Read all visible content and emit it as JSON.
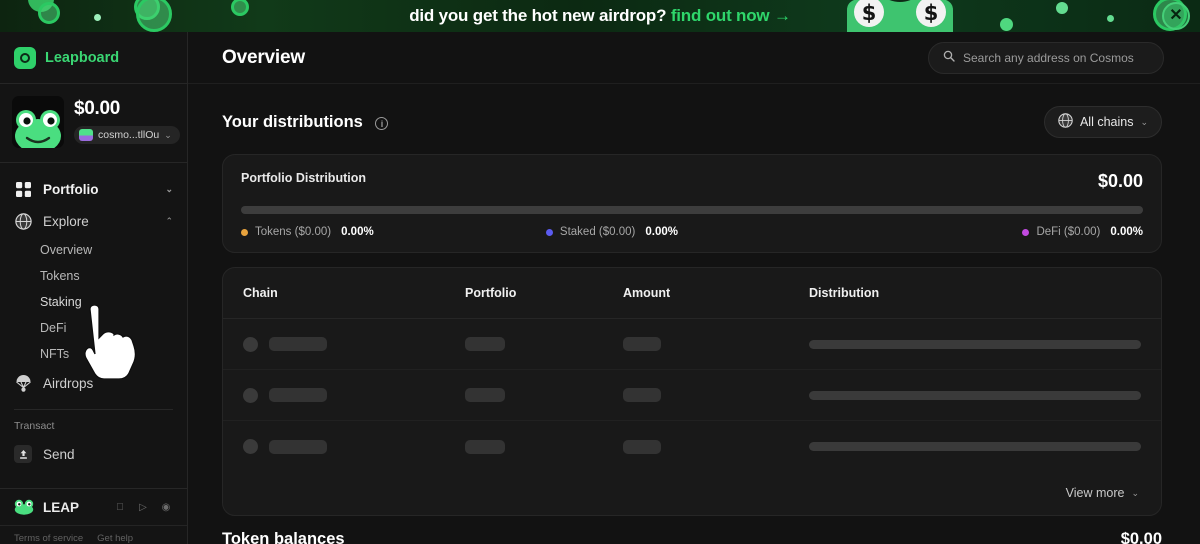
{
  "banner": {
    "text_main": "did you get the hot new airdrop?",
    "text_cta": "find out now →",
    "close_label": "✕",
    "accent": "#2fd66b"
  },
  "sidebar": {
    "brand": {
      "name": "Leapboard",
      "logo_icon": "leapboard-logo-icon",
      "color": "#3ad673"
    },
    "account": {
      "balance": "$0.00",
      "address": "cosmo...tllOu",
      "chevron": "⌄",
      "avatar_icon": "frog-avatar"
    },
    "nav": [
      {
        "label": "Portfolio",
        "icon": "grid-icon",
        "chevron": "⌄",
        "type": "group"
      },
      {
        "label": "Explore",
        "icon": "globe-icon",
        "chevron": "⌃",
        "type": "group"
      }
    ],
    "explore_children": [
      {
        "label": "Overview"
      },
      {
        "label": "Tokens"
      },
      {
        "label": "Staking"
      },
      {
        "label": "DeFi"
      },
      {
        "label": "NFTs"
      }
    ],
    "airdrops": {
      "label": "Airdrops",
      "icon": "parachute-icon"
    },
    "transact_label": "Transact",
    "send": {
      "label": "Send",
      "icon": "send-upload-icon"
    },
    "leap": {
      "name": "LEAP",
      "stores": [
        "apple-icon",
        "play-store-icon",
        "browser-extension-icon"
      ]
    },
    "footer": [
      {
        "label": "Terms of service"
      },
      {
        "label": "Get help"
      }
    ]
  },
  "topbar": {
    "title": "Overview",
    "search": {
      "placeholder": "Search any address on Cosmos",
      "value": "",
      "icon": "search-icon"
    }
  },
  "main": {
    "section_title": "Your distributions",
    "info_icon": "info-icon",
    "chains_filter": {
      "label": "All chains",
      "icon": "globe-icon",
      "chevron": "⌄"
    },
    "portfolio_card": {
      "title": "Portfolio Distribution",
      "amount": "$0.00",
      "legend": [
        {
          "label": "Tokens ($0.00)",
          "value": "0.00%",
          "color": "#e8a33d"
        },
        {
          "label": "Staked ($0.00)",
          "value": "0.00%",
          "color": "#5b5bf0"
        },
        {
          "label": "DeFi ($0.00)",
          "value": "0.00%",
          "color": "#c24ae0"
        }
      ]
    },
    "table": {
      "columns": [
        "Chain",
        "Portfolio",
        "Amount",
        "Distribution"
      ],
      "rows": [
        {
          "loading": true
        },
        {
          "loading": true
        },
        {
          "loading": true
        }
      ],
      "view_more": {
        "label": "View more",
        "chevron": "⌄"
      }
    },
    "next_section": {
      "title": "Token balances",
      "amount": "$0.00"
    }
  },
  "chart_data": {
    "type": "bar",
    "title": "Portfolio Distribution",
    "categories": [
      "Tokens",
      "Staked",
      "DeFi"
    ],
    "values": [
      0.0,
      0.0,
      0.0
    ],
    "value_labels": [
      "0.00%",
      "0.00%",
      "0.00%"
    ],
    "amounts": [
      "$0.00",
      "$0.00",
      "$0.00"
    ],
    "total": "$0.00",
    "colors": [
      "#e8a33d",
      "#5b5bf0",
      "#c24ae0"
    ],
    "ylim": [
      0,
      100
    ],
    "ylabel": "",
    "xlabel": "",
    "legend_position": "bottom"
  }
}
